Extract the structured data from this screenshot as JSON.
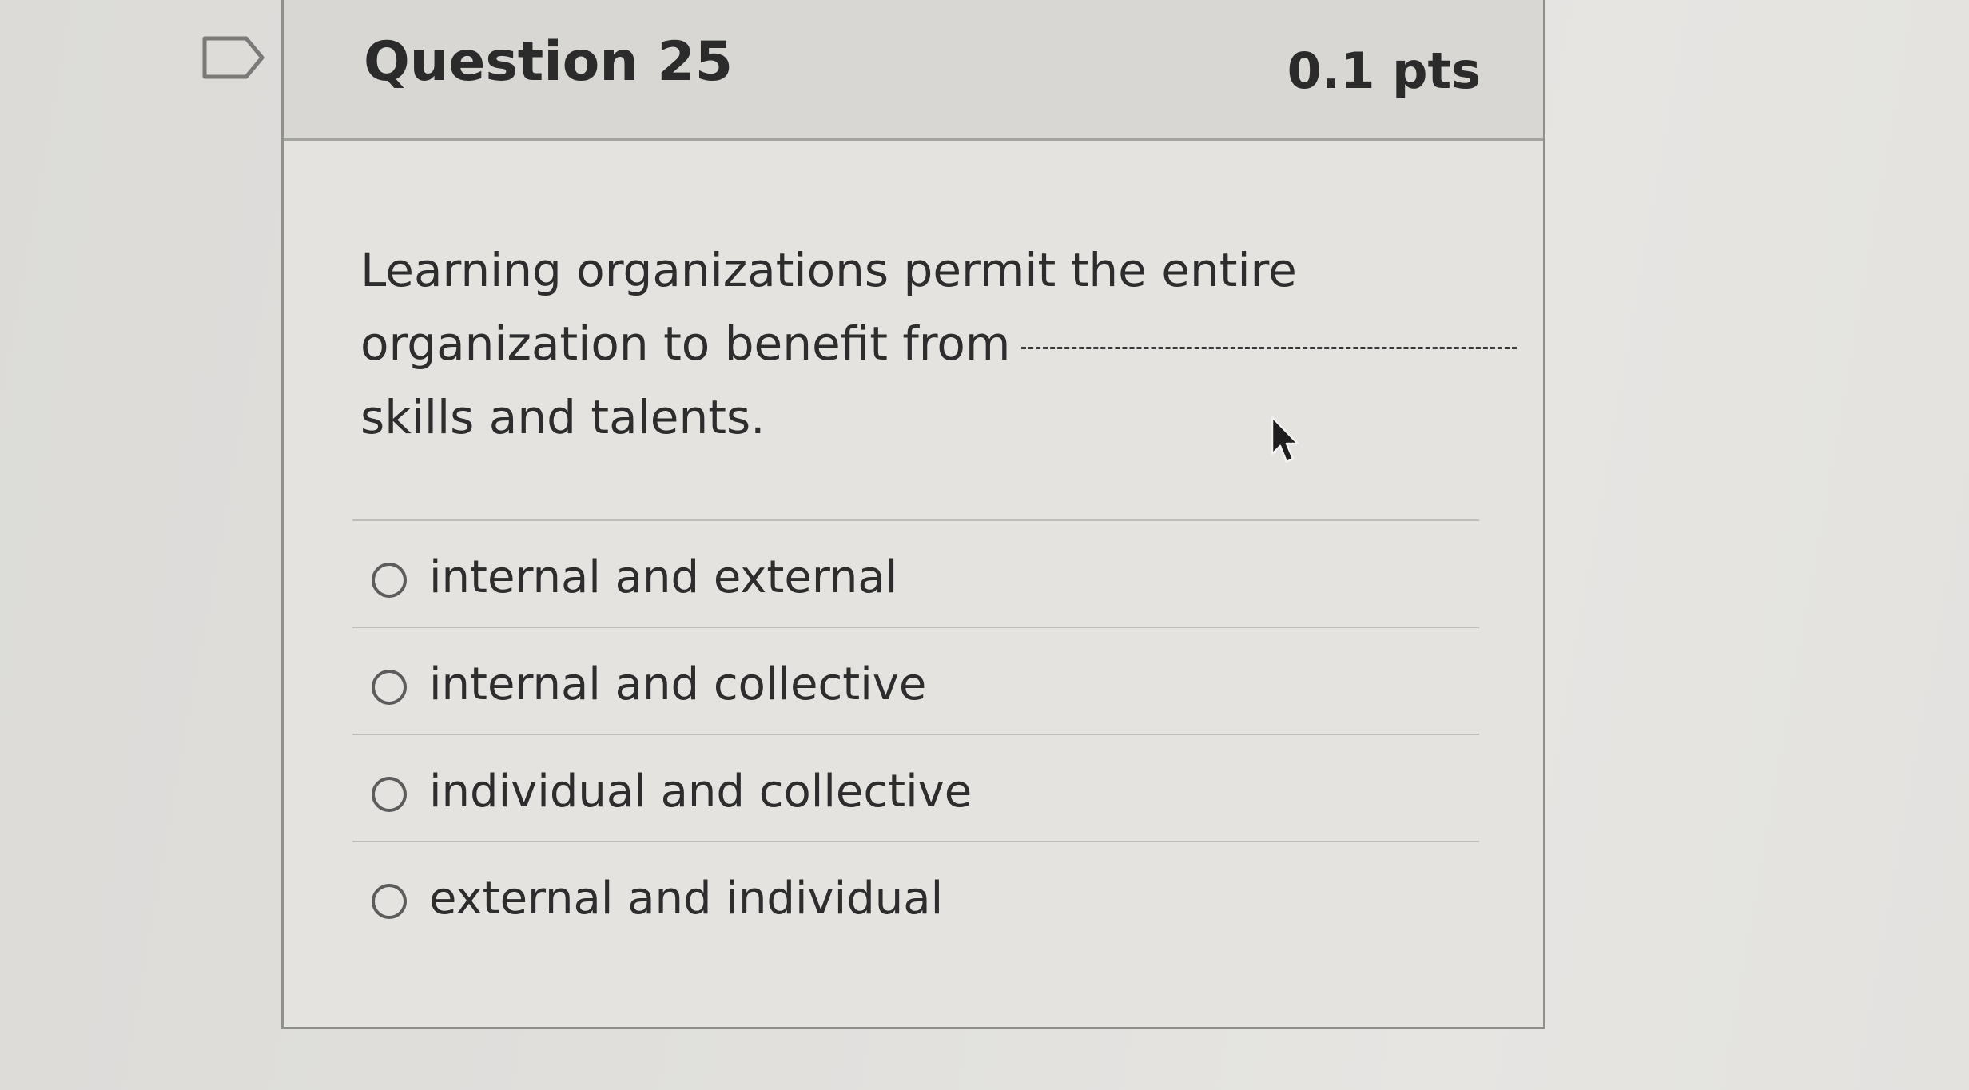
{
  "question": {
    "title": "Question 25",
    "points": "0.1 pts",
    "text_line1": "Learning organizations permit the entire",
    "text_line2": "organization to benefit from",
    "text_line3": "skills and talents."
  },
  "answers": [
    {
      "label": "internal and external",
      "selected": false
    },
    {
      "label": "internal and collective",
      "selected": false
    },
    {
      "label": "individual and collective",
      "selected": false
    },
    {
      "label": "external and individual",
      "selected": false
    }
  ],
  "icons": {
    "flag": "bookmark-flag-icon",
    "cursor": "mouse-pointer-icon"
  },
  "colors": {
    "text": "#2d2d2d",
    "header_bg": "#d8d7d4",
    "border": "#8f8f8c"
  }
}
